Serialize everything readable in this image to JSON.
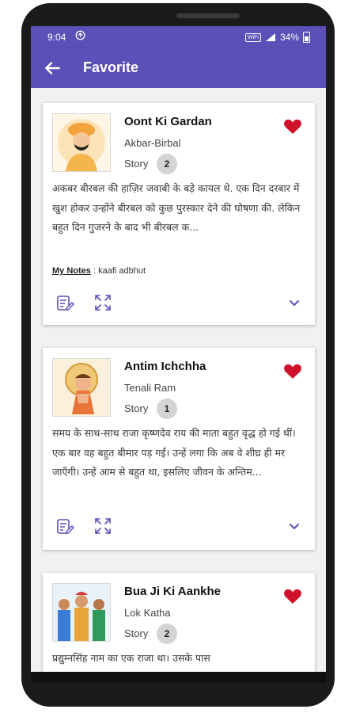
{
  "status_bar": {
    "time": "9:04",
    "network_tag": "WiFi",
    "battery": "34%"
  },
  "app_bar": {
    "title": "Favorite"
  },
  "cards": [
    {
      "title": "Oont Ki Gardan",
      "category": "Akbar-Birbal",
      "story_label": "Story",
      "story_number": "2",
      "excerpt": "अकबर बीरबल की हाज़िर जवाबी के बड़े कायल थे. एक दिन दरबार में खुश होकर उन्होंने बीरबल को कुछ पुरस्कार देने की घोषणा की. लेकिन बहुत दिन गुजरने के बाद भी बीरबल क...",
      "notes_label": "My Notes",
      "notes_sep": " : ",
      "notes_text": "kaafi adbhut"
    },
    {
      "title": "Antim Ichchha",
      "category": "Tenali Ram",
      "story_label": "Story",
      "story_number": "1",
      "excerpt": "समय के साथ-साथ राजा कृष्णदेव राय की माता बहुत वृद्ध हो गई थीं। एक बार वह बहुत बीमार पड़ गईं। उन्हें लगा कि अब वे शीघ्र ही मर जाएँगी। उन्हें आम से बहुत था, इसलिए जीवन के अन्तिम..."
    },
    {
      "title": "Bua Ji Ki Aankhe",
      "category": "Lok Katha",
      "story_label": "Story",
      "story_number": "2",
      "excerpt": "प्रद्युम्नसिंह नाम का एक राजा था। उसके पास"
    }
  ],
  "colors": {
    "primary": "#5c4fb8",
    "heart": "#d0112b",
    "icon": "#5c4fb8"
  }
}
